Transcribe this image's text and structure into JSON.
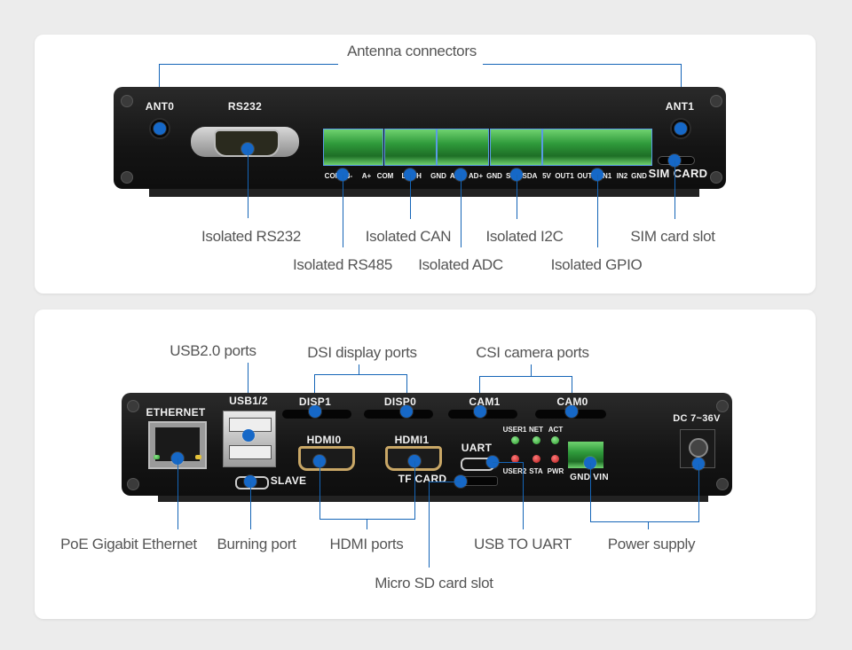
{
  "top_panel": {
    "title_label": "Antenna connectors",
    "silkscreen": {
      "ant0": "ANT0",
      "rs232": "RS232",
      "ant1": "ANT1",
      "sim_card": "SIM CARD",
      "pins": [
        "COM",
        "B-",
        "A+",
        "COM",
        "L",
        "H",
        "GND",
        "AD-",
        "AD+",
        "GND",
        "SCL",
        "SDA",
        "5V",
        "OUT1",
        "OUT2",
        "IN1",
        "IN2",
        "GND"
      ]
    },
    "callouts": {
      "isolated_rs232": "Isolated RS232",
      "isolated_rs485": "Isolated RS485",
      "isolated_can": "Isolated CAN",
      "isolated_adc": "Isolated ADC",
      "isolated_i2c": "Isolated I2C",
      "isolated_gpio": "Isolated GPIO",
      "sim_card_slot": "SIM card slot"
    }
  },
  "bottom_panel": {
    "silkscreen": {
      "ethernet": "ETHERNET",
      "usb12": "USB1/2",
      "disp1": "DISP1",
      "disp0": "DISP0",
      "cam1": "CAM1",
      "cam0": "CAM0",
      "hdmi0": "HDMI0",
      "hdmi1": "HDMI1",
      "uart": "UART",
      "slave": "SLAVE",
      "tf_card": "TF CARD",
      "user1": "USER1",
      "net": "NET",
      "act": "ACT",
      "user2": "USER2",
      "sta": "STA",
      "pwr": "PWR",
      "gnd_vin": "GND VIN",
      "dc": "DC 7~36V"
    },
    "callouts": {
      "usb20_ports": "USB2.0 ports",
      "dsi_display_ports": "DSI display ports",
      "csi_camera_ports": "CSI camera ports",
      "poe_gigabit_ethernet": "PoE Gigabit Ethernet",
      "burning_port": "Burning port",
      "hdmi_ports": "HDMI ports",
      "usb_to_uart": "USB TO UART",
      "power_supply": "Power supply",
      "micro_sd_card_slot": "Micro SD card slot"
    }
  },
  "colors": {
    "leader_line": "#1565b7",
    "marker_dot": "#1668c7",
    "label_text": "#555555",
    "terminal_green": "#2f9a3b"
  }
}
